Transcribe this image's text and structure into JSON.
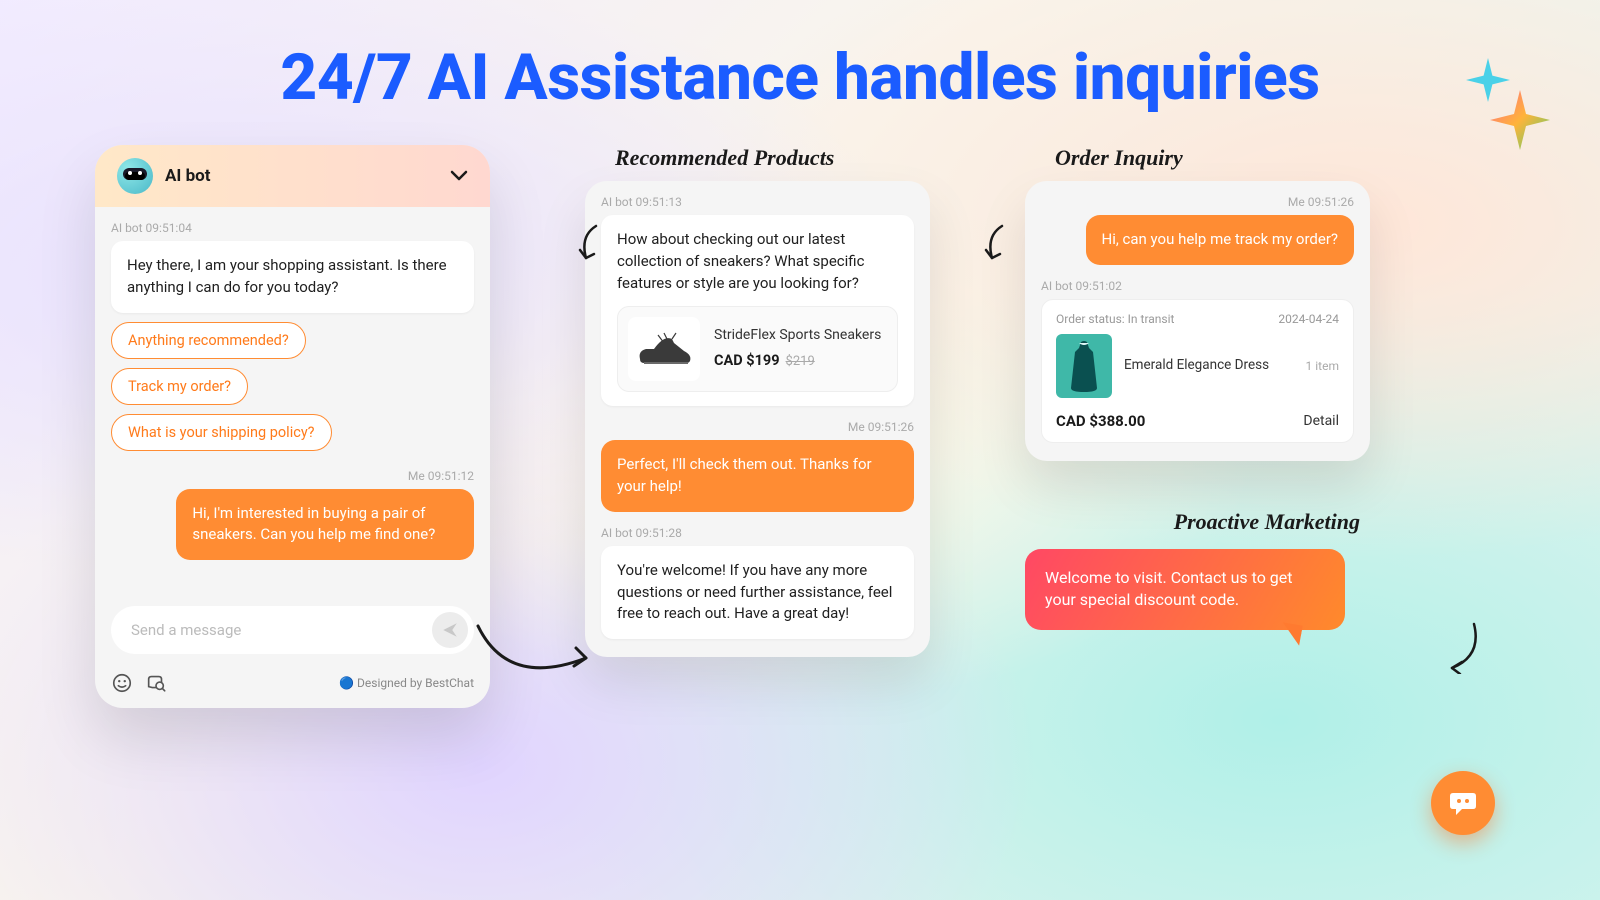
{
  "headline": "24/7 AI Assistance handles inquiries",
  "panel1": {
    "header_title": "AI bot",
    "bot_ts": "AI bot 09:51:04",
    "bot_msg": "Hey there, I am your shopping assistant. Is there anything I can do for you today?",
    "quick_replies": [
      "Anything recommended?",
      "Track my order?",
      "What is your shipping policy?"
    ],
    "me_ts": "Me 09:51:12",
    "me_msg": "Hi, I'm interested in buying a pair of sneakers. Can you help me find one?",
    "composer_placeholder": "Send a message",
    "credit": "Designed by BestChat"
  },
  "panel2": {
    "callout": "Recommended Products",
    "bot_ts1": "AI bot 09:51:13",
    "bot_msg1": "How about checking out our latest collection of sneakers? What specific features or style are you looking for?",
    "product_name": "StrideFlex Sports Sneakers",
    "product_price": "CAD $199",
    "product_old_price": "$219",
    "me_ts": "Me 09:51:26",
    "me_msg": "Perfect, I'll check them out. Thanks for your help!",
    "bot_ts2": "AI bot 09:51:28",
    "bot_msg2": "You're welcome! If you have any more questions or need further assistance, feel free to reach out. Have a great day!"
  },
  "panel3": {
    "callout": "Order Inquiry",
    "me_ts": "Me 09:51:26",
    "me_msg": "Hi, can you help me track my order?",
    "bot_ts": "AI bot 09:51:02",
    "order_status": "Order status: In transit",
    "order_date": "2024-04-24",
    "order_product": "Emerald Elegance Dress",
    "order_qty": "1 item",
    "order_total": "CAD $388.00",
    "detail_label": "Detail"
  },
  "marketing": {
    "callout": "Proactive Marketing",
    "message": "Welcome to visit. Contact us to get your special discount code."
  }
}
